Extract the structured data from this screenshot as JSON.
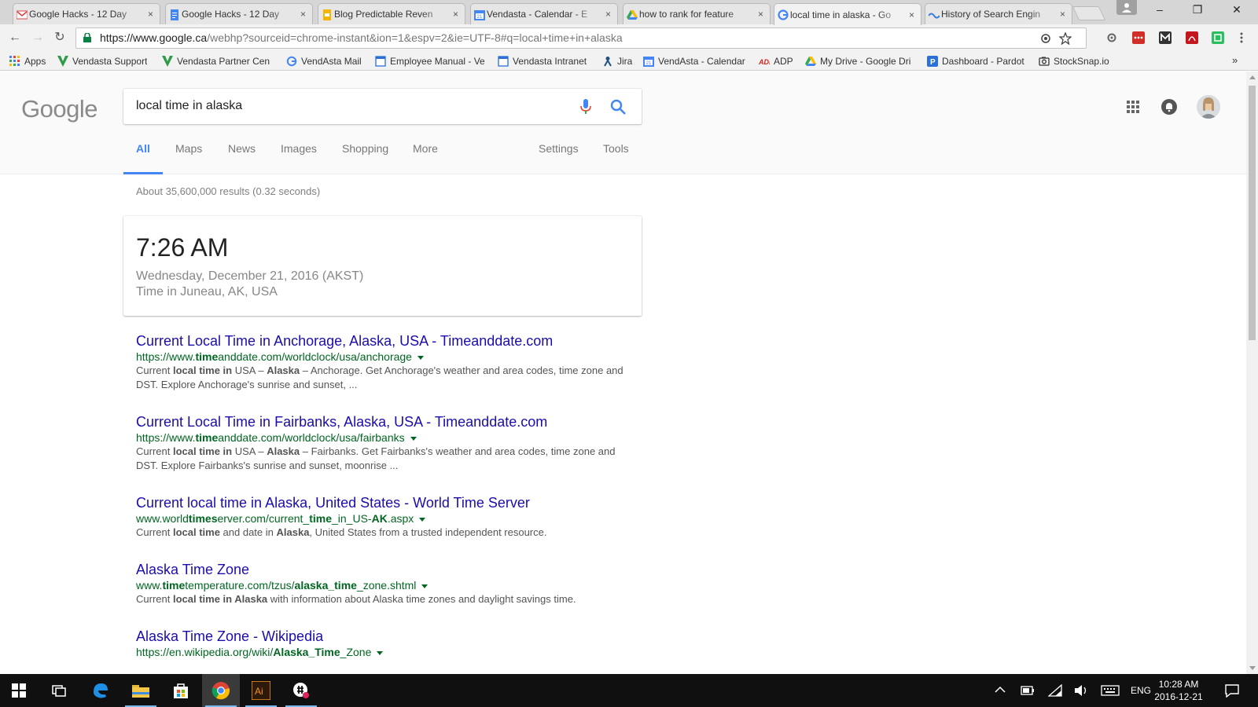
{
  "browser": {
    "tabs": [
      {
        "label": "Google Hacks - 12 Day",
        "icon": "gmail-icon",
        "close": "×"
      },
      {
        "label": "Google Hacks - 12 Day",
        "icon": "docs-icon",
        "close": "×"
      },
      {
        "label": "Blog Predictable Reven",
        "icon": "slides-icon",
        "close": "×"
      },
      {
        "label": "Vendasta - Calendar - E",
        "icon": "calendar-icon",
        "close": "×"
      },
      {
        "label": "how to rank for feature",
        "icon": "drive-icon",
        "close": "×"
      },
      {
        "label": "local time in alaska - Go",
        "icon": "google-icon",
        "close": "×"
      },
      {
        "label": "History of Search Engin",
        "icon": "wave-icon",
        "close": "×"
      }
    ],
    "window_controls": {
      "minimize": "–",
      "maximize": "❐",
      "close": "✕"
    },
    "url_host": "https://www.google.ca",
    "url_path": "/webhp?sourceid=chrome-instant&ion=1&espv=2&ie=UTF-8#q=local+time+in+alaska",
    "nav": {
      "back": "←",
      "forward": "→",
      "reload": "↻"
    },
    "bookmarks": [
      {
        "label": "Apps",
        "icon": "apps-grid-icon"
      },
      {
        "label": "Vendasta Support",
        "icon": "vendasta-icon"
      },
      {
        "label": "Vendasta Partner Cen",
        "icon": "vendasta-icon"
      },
      {
        "label": "VendAsta Mail",
        "icon": "google-icon"
      },
      {
        "label": "Employee Manual - Ve",
        "icon": "page-icon"
      },
      {
        "label": "Vendasta Intranet",
        "icon": "page-icon"
      },
      {
        "label": "Jira",
        "icon": "jira-icon"
      },
      {
        "label": "VendAsta - Calendar",
        "icon": "calendar-icon"
      },
      {
        "label": "ADP",
        "icon": "adp-icon"
      },
      {
        "label": "My Drive - Google Dri",
        "icon": "drive-icon"
      },
      {
        "label": "Dashboard - Pardot",
        "icon": "pardot-icon"
      },
      {
        "label": "StockSnap.io",
        "icon": "camera-icon"
      }
    ],
    "bookmarks_more": "»"
  },
  "google": {
    "logo": "Google",
    "query": "local time in alaska",
    "nav_tabs": [
      "All",
      "Maps",
      "News",
      "Images",
      "Shopping",
      "More",
      "Settings",
      "Tools"
    ],
    "results_count": "About 35,600,000 results (0.32 seconds)",
    "time_card": {
      "time": "7:26 AM",
      "date": "Wednesday, December 21, 2016 (AKST)",
      "place": "Time in Juneau, AK, USA"
    },
    "results": [
      {
        "title": "Current Local Time in Anchorage, Alaska, USA - Timeanddate.com",
        "url_parts": [
          "https://www.",
          "time",
          "anddate.com/worldclock/usa/anchorage"
        ],
        "snippet_parts": [
          "Current ",
          "local time in",
          " USA – ",
          "Alaska",
          " – Anchorage. Get Anchorage's weather and area codes, time zone and DST. Explore Anchorage's sunrise and sunset, ..."
        ]
      },
      {
        "title": "Current Local Time in Fairbanks, Alaska, USA - Timeanddate.com",
        "url_parts": [
          "https://www.",
          "time",
          "anddate.com/worldclock/usa/fairbanks"
        ],
        "snippet_parts": [
          "Current ",
          "local time in",
          " USA – ",
          "Alaska",
          " – Fairbanks. Get Fairbanks's weather and area codes, time zone and DST. Explore Fairbanks's sunrise and sunset, moonrise ..."
        ]
      },
      {
        "title": "Current local time in Alaska, United States - World Time Server",
        "url_parts": [
          "www.world",
          "times",
          "erver.com/current_",
          "time",
          "_in_US-",
          "AK",
          ".aspx"
        ],
        "snippet_parts": [
          "Current ",
          "local time",
          " and date in ",
          "Alaska",
          ", United States from a trusted independent resource."
        ]
      },
      {
        "title": "Alaska Time Zone",
        "url_parts": [
          "www.",
          "time",
          "temperature.com/tzus/",
          "alaska_time",
          "_zone.shtml"
        ],
        "snippet_parts": [
          "Current ",
          "local time in Alaska",
          " with information about Alaska time zones and daylight savings time."
        ]
      },
      {
        "title": "Alaska Time Zone - Wikipedia",
        "url_parts": [
          "https://en.wikipedia.org/wiki/",
          "Alaska_Time",
          "_Zone"
        ],
        "snippet_parts": []
      }
    ]
  },
  "taskbar": {
    "language": "ENG",
    "clock_time": "10:28 AM",
    "clock_date": "2016-12-21",
    "apps": [
      "windows-start-icon",
      "task-view-icon",
      "edge-icon",
      "file-explorer-icon",
      "store-icon",
      "chrome-icon",
      "illustrator-icon",
      "slack-like-icon"
    ]
  },
  "colors": {
    "link": "#1a0dab",
    "url_green": "#006621",
    "active_tab_blue": "#4285f4"
  }
}
